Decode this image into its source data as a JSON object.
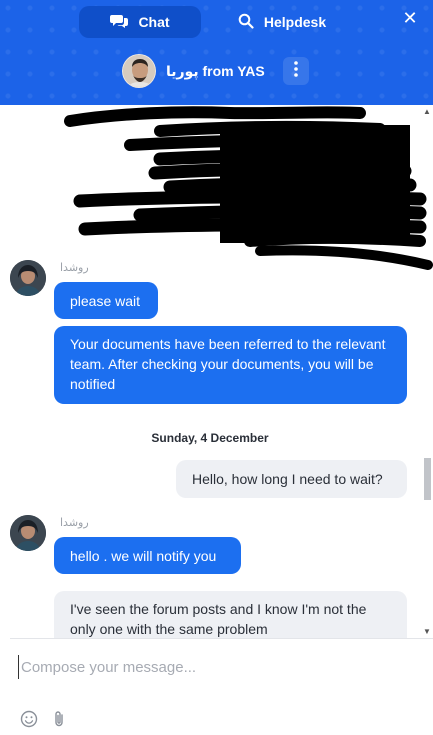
{
  "header": {
    "tabs": [
      {
        "label": "Chat",
        "icon": "chat-bubbles-icon",
        "active": true
      },
      {
        "label": "Helpdesk",
        "icon": "search-icon",
        "active": false
      }
    ],
    "close_symbol": "✕",
    "agent_label": "پوریا from YAS"
  },
  "messages": {
    "group1": {
      "sender": "روشدا",
      "bubbles": [
        "please wait",
        "Your documents have been referred to the relevant team. After checking your documents, you will be notified"
      ]
    },
    "date_separator": "Sunday, 4 December",
    "user_msg1": "Hello, how long I need to wait?",
    "group2": {
      "sender": "روشدا",
      "bubbles": [
        "hello . we will notify you"
      ]
    },
    "user_msg2": "I've seen the forum posts and I know I'm not the only one with the same problem"
  },
  "composer": {
    "placeholder": "Compose your message...",
    "icons": [
      "emoji-icon",
      "attachment-icon"
    ]
  },
  "colors": {
    "header_blue": "#1c63e8",
    "active_tab": "#0f4fc9",
    "agent_bubble": "#1c6ff0",
    "user_bubble": "#eef0f4"
  }
}
